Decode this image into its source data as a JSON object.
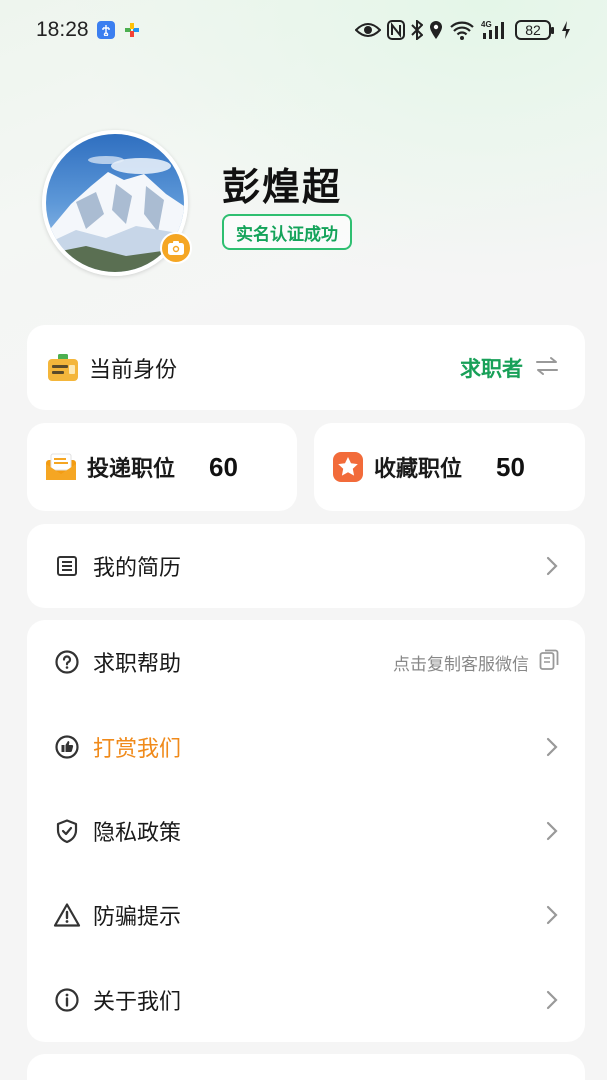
{
  "status_bar": {
    "time": "18:28",
    "icons": [
      "usb-app-icon",
      "colorful-app-icon",
      "eye-icon",
      "nfc-icon",
      "bluetooth-icon",
      "location-icon",
      "wifi-icon",
      "cellular-4g-icon",
      "battery-icon",
      "charging-icon"
    ],
    "battery_level": "82",
    "network_label": "4G"
  },
  "profile": {
    "name": "彭煌超",
    "verify_badge": "实名认证成功",
    "avatar_icon": "mountain-landscape-avatar",
    "camera_icon": "camera-icon"
  },
  "identity": {
    "label": "当前身份",
    "value": "求职者",
    "icon": "id-card-icon",
    "switch_icon": "swap-arrows-icon"
  },
  "stats": {
    "applied": {
      "label": "投递职位",
      "value": "60",
      "icon": "envelope-icon"
    },
    "favorites": {
      "label": "收藏职位",
      "value": "50",
      "icon": "star-icon"
    }
  },
  "resume": {
    "label": "我的简历",
    "icon": "document-icon"
  },
  "menu": {
    "help": {
      "label": "求职帮助",
      "hint": "点击复制客服微信",
      "icon": "question-circle-icon",
      "hint_icon": "copy-icon"
    },
    "reward": {
      "label": "打赏我们",
      "icon": "thumbs-up-circle-icon"
    },
    "privacy": {
      "label": "隐私政策",
      "icon": "shield-check-icon"
    },
    "fraud": {
      "label": "防骗提示",
      "icon": "warning-triangle-icon"
    },
    "about": {
      "label": "关于我们",
      "icon": "info-circle-icon"
    }
  },
  "colors": {
    "accent_green": "#18a058",
    "badge_green": "#2fbf71",
    "reward_orange": "#f08a1a",
    "camera_badge": "#f5a623"
  }
}
